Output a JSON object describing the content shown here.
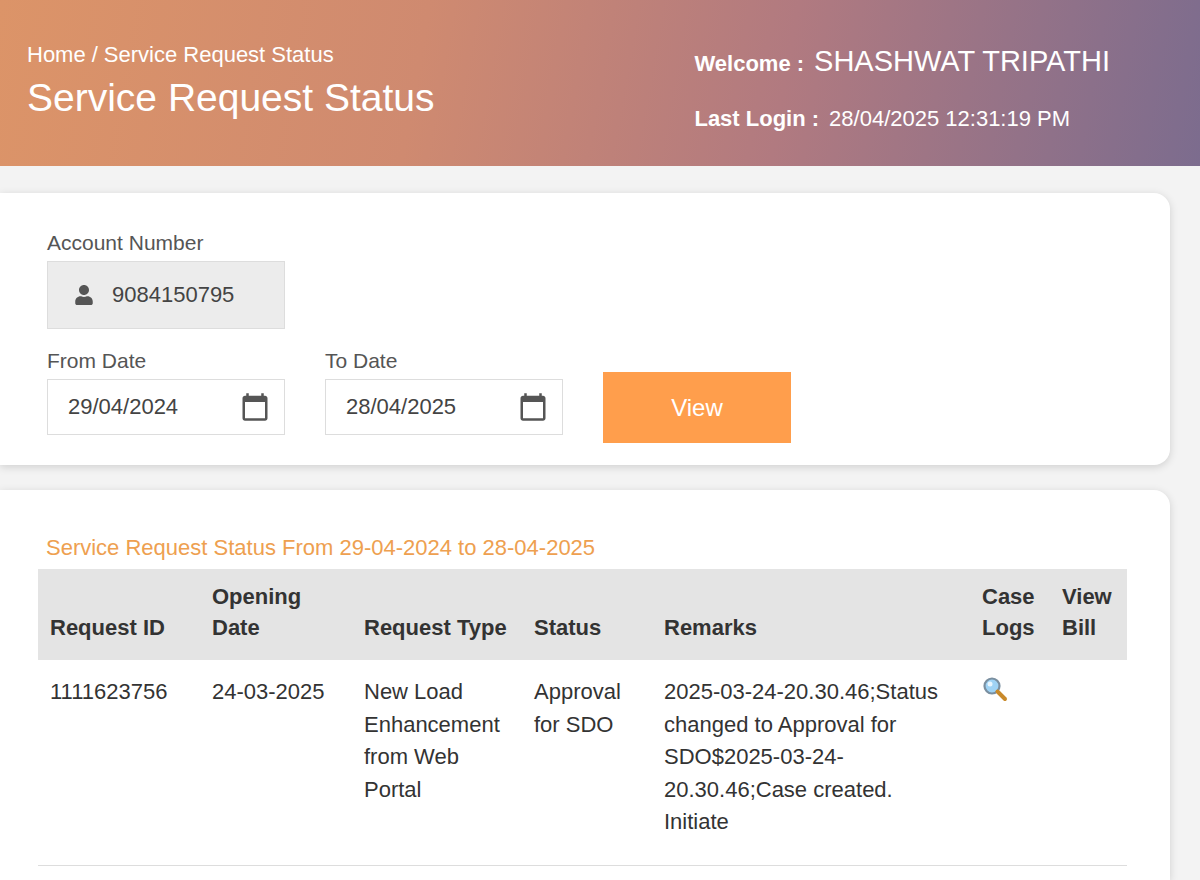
{
  "breadcrumb": {
    "items": [
      "Home",
      "Service Request Status"
    ],
    "separator": "/"
  },
  "page_title": "Service Request Status",
  "welcome": {
    "label": "Welcome :",
    "name": "SHASHWAT TRIPATHI"
  },
  "last_login": {
    "label": "Last Login :",
    "value": "28/04/2025 12:31:19 PM"
  },
  "form": {
    "account_number": {
      "label": "Account Number",
      "value": "9084150795"
    },
    "from_date": {
      "label": "From Date",
      "value": "29/04/2024"
    },
    "to_date": {
      "label": "To Date",
      "value": "28/04/2025"
    },
    "button": "View"
  },
  "table": {
    "title": "Service Request Status From 29-04-2024 to 28-04-2025",
    "columns": [
      "Request ID",
      "Opening Date",
      "Request Type",
      "Status",
      "Remarks",
      "Case Logs",
      "View Bill"
    ],
    "rows": [
      {
        "cells": [
          "1111623756",
          "24-03-2025",
          "New Load Enhancement from Web Portal",
          "Approval for SDO",
          "2025-03-24-20.30.46;Status changed to Approval for SDO$2025-03-24-20.30.46;Case created. Initiate"
        ]
      }
    ]
  }
}
